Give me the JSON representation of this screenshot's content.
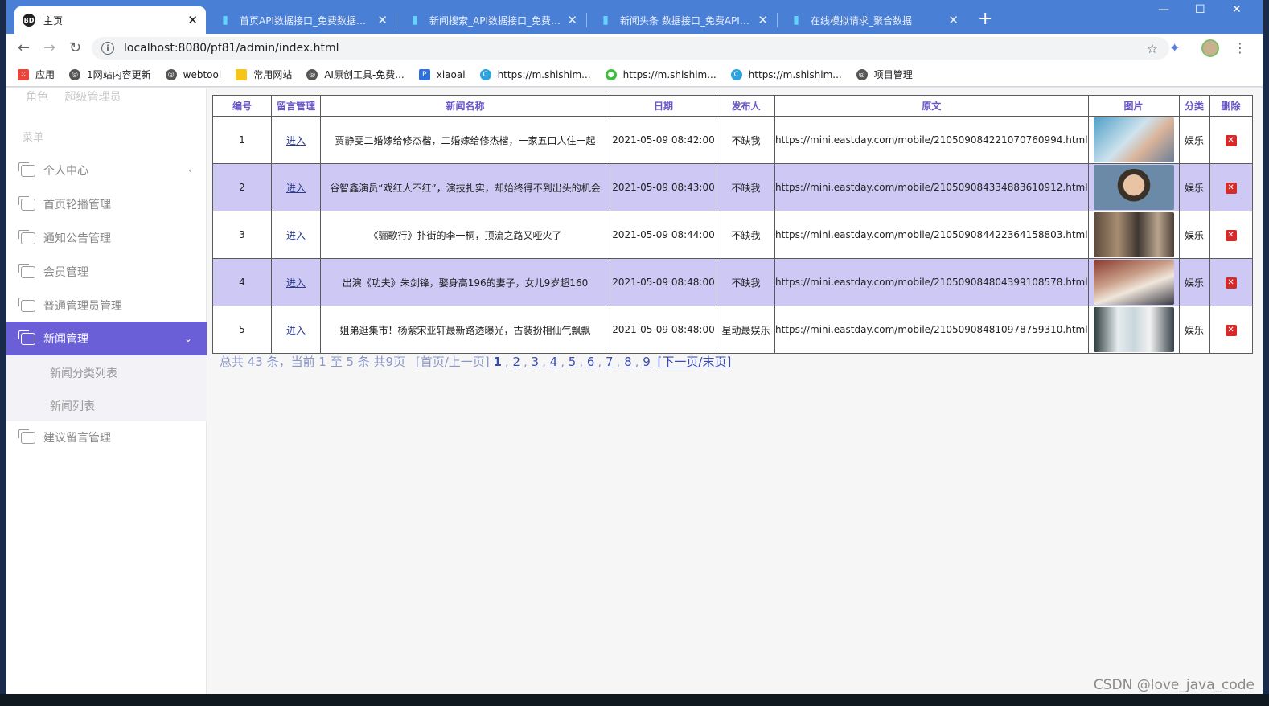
{
  "browser": {
    "tabs": [
      {
        "title": "主页",
        "active": true
      },
      {
        "title": "首页API数据接口_免费数据调用",
        "active": false
      },
      {
        "title": "新闻搜索_API数据接口_免费数据",
        "active": false
      },
      {
        "title": "新闻头条 数据接口_免费API接口",
        "active": false
      },
      {
        "title": "在线模拟请求_聚合数据",
        "active": false
      }
    ],
    "url": "localhost:8080/pf81/admin/index.html",
    "bookmarks": [
      "应用",
      "1网站内容更新",
      "webtool",
      "常用网站",
      "AI原创工具-免费...",
      "xiaoai",
      "https://m.shishim...",
      "https://m.shishim...",
      "https://m.shishim...",
      "项目管理"
    ]
  },
  "sidebar": {
    "role_label": "角色",
    "role_value": "超级管理员",
    "menu_title": "菜单",
    "items": [
      {
        "label": "个人中心",
        "arrow": "‹"
      },
      {
        "label": "首页轮播管理"
      },
      {
        "label": "通知公告管理"
      },
      {
        "label": "会员管理"
      },
      {
        "label": "普通管理员管理"
      },
      {
        "label": "新闻管理",
        "arrow": "⌄",
        "active": true
      },
      {
        "label": "建议留言管理"
      }
    ],
    "subitems": [
      "新闻分类列表",
      "新闻列表"
    ]
  },
  "table": {
    "headers": [
      "编号",
      "留言管理",
      "新闻名称",
      "日期",
      "发布人",
      "原文",
      "图片",
      "分类",
      "删除"
    ],
    "rows": [
      {
        "id": "1",
        "action": "进入",
        "title": "贾静雯二婚嫁给修杰楷，二婚嫁给修杰楷，一家五口人住一起",
        "date": "2021-05-09 08:42:00",
        "author": "不缺我",
        "url": "https://mini.eastday.com/mobile/210509084221070760994.html",
        "category": "娱乐"
      },
      {
        "id": "2",
        "action": "进入",
        "title": "谷智鑫演员“戏红人不红”，演技扎实，却始终得不到出头的机会",
        "date": "2021-05-09 08:43:00",
        "author": "不缺我",
        "url": "https://mini.eastday.com/mobile/210509084334883610912.html",
        "category": "娱乐"
      },
      {
        "id": "3",
        "action": "进入",
        "title": "《骊歌行》扑街的李一桐，顶流之路又哑火了",
        "date": "2021-05-09 08:44:00",
        "author": "不缺我",
        "url": "https://mini.eastday.com/mobile/210509084422364158803.html",
        "category": "娱乐"
      },
      {
        "id": "4",
        "action": "进入",
        "title": "出演《功夫》朱剑锋，娶身高196的妻子，女儿9岁超160",
        "date": "2021-05-09 08:48:00",
        "author": "不缺我",
        "url": "https://mini.eastday.com/mobile/210509084804399108578.html",
        "category": "娱乐"
      },
      {
        "id": "5",
        "action": "进入",
        "title": "姐弟逛集市！杨紫宋亚轩最新路透曝光，古装扮相仙气飘飘",
        "date": "2021-05-09 08:48:00",
        "author": "星动最娱乐",
        "url": "https://mini.eastday.com/mobile/210509084810978759310.html",
        "category": "娱乐"
      }
    ]
  },
  "pager": {
    "summary": "总共 43 条，当前 1 至 5 条 共9页",
    "first_prev": "[首页/上一页]",
    "pages": [
      "1",
      "2",
      "3",
      "4",
      "5",
      "6",
      "7",
      "8",
      "9"
    ],
    "next": "下一页",
    "last": "末页"
  },
  "watermark": "CSDN @love_java_code",
  "colors": {
    "tabstrip": "#4a7fd6",
    "accent": "#6a5fd7",
    "row_alt": "#cec8f4",
    "header_text": "#6a55c9",
    "delete": "#d32a2a"
  }
}
